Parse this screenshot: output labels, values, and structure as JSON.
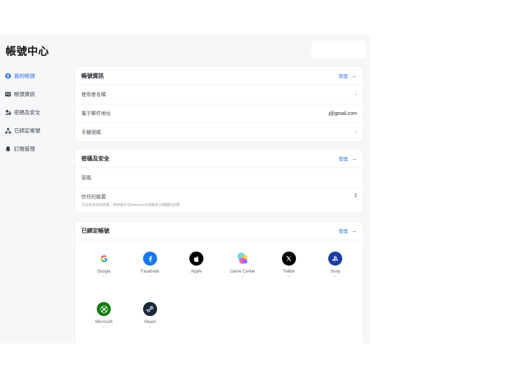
{
  "page_title": "帳號中心",
  "sidebar": {
    "items": [
      {
        "label": "我的帳號",
        "icon": "user-circle-icon",
        "active": true
      },
      {
        "label": "帳號資訊",
        "icon": "id-card-icon",
        "active": false
      },
      {
        "label": "密碼及安全",
        "icon": "lock-user-icon",
        "active": false
      },
      {
        "label": "已綁定帳號",
        "icon": "link-nodes-icon",
        "active": false
      },
      {
        "label": "訂閱管理",
        "icon": "bell-icon",
        "active": false
      }
    ]
  },
  "account_info": {
    "title": "帳號資訊",
    "manage": "管理",
    "rows": [
      {
        "label": "使用者名稱",
        "value": "-"
      },
      {
        "label": "電子郵件地址",
        "value": "j@gmail.com"
      },
      {
        "label": "手機號碼",
        "value": "-"
      }
    ]
  },
  "security": {
    "title": "密碼及安全",
    "manage": "管理",
    "password_label": "密碼",
    "trusted_label": "信任的裝置",
    "trusted_value": "1",
    "trusted_note": "凡是受信任的裝置，使用者可在Airtreons中啟動各分類器的步驟"
  },
  "linked": {
    "title": "已綁定帳號",
    "manage": "管理",
    "accounts": [
      {
        "name": "Google",
        "status": "-",
        "icon": "google-icon"
      },
      {
        "name": "Facebook",
        "status": "-",
        "icon": "facebook-icon"
      },
      {
        "name": "Apple",
        "status": "-",
        "icon": "apple-icon"
      },
      {
        "name": "Game Center",
        "status": "-",
        "icon": "game-center-icon"
      },
      {
        "name": "Twitter",
        "status": "-",
        "icon": "x-twitter-icon"
      },
      {
        "name": "Sony",
        "status": "-",
        "icon": "playstation-icon"
      },
      {
        "name": "Microsoft",
        "status": "-",
        "icon": "xbox-icon"
      },
      {
        "name": "Steam",
        "status": "-",
        "icon": "steam-icon"
      }
    ]
  },
  "colors": {
    "accent": "#2f6fe0",
    "facebook": "#1877f2",
    "sony": "#1b3fa0",
    "xbox": "#107c10",
    "steam": "#1b2838"
  }
}
